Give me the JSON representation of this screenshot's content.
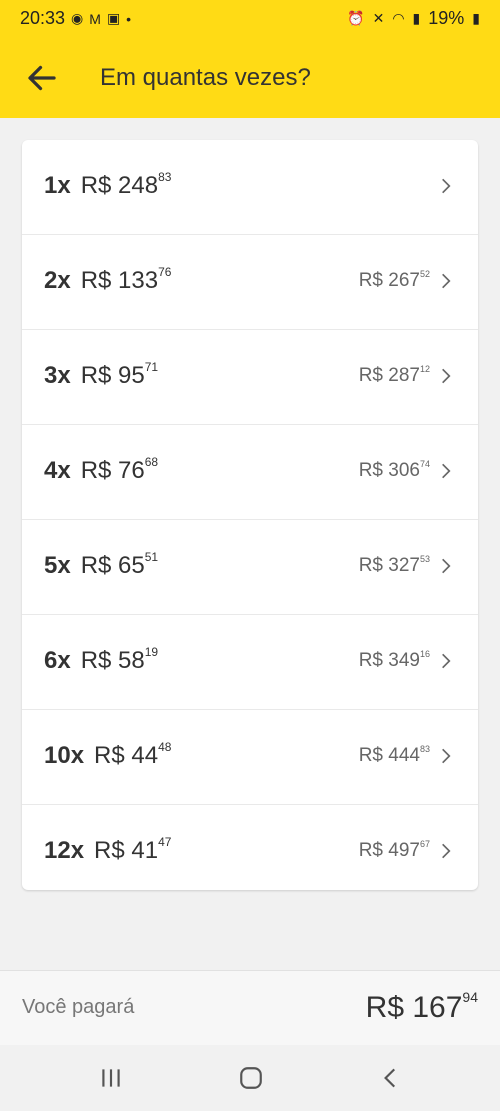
{
  "status": {
    "time": "20:33",
    "battery": "19%"
  },
  "header": {
    "title": "Em quantas vezes?"
  },
  "options": [
    {
      "count": "1x",
      "installment": "R$ 248",
      "installment_cents": "83",
      "total": "",
      "total_cents": ""
    },
    {
      "count": "2x",
      "installment": "R$ 133",
      "installment_cents": "76",
      "total": "R$ 267",
      "total_cents": "52"
    },
    {
      "count": "3x",
      "installment": "R$ 95",
      "installment_cents": "71",
      "total": "R$ 287",
      "total_cents": "12"
    },
    {
      "count": "4x",
      "installment": "R$ 76",
      "installment_cents": "68",
      "total": "R$ 306",
      "total_cents": "74"
    },
    {
      "count": "5x",
      "installment": "R$ 65",
      "installment_cents": "51",
      "total": "R$ 327",
      "total_cents": "53"
    },
    {
      "count": "6x",
      "installment": "R$ 58",
      "installment_cents": "19",
      "total": "R$ 349",
      "total_cents": "16"
    },
    {
      "count": "10x",
      "installment": "R$ 44",
      "installment_cents": "48",
      "total": "R$ 444",
      "total_cents": "83"
    },
    {
      "count": "12x",
      "installment": "R$ 41",
      "installment_cents": "47",
      "total": "R$ 497",
      "total_cents": "67"
    }
  ],
  "footer": {
    "label": "Você pagará",
    "amount": "R$ 167",
    "amount_cents": "94"
  },
  "colors": {
    "brand": "#ffdb15",
    "background": "#f1f1f1"
  }
}
